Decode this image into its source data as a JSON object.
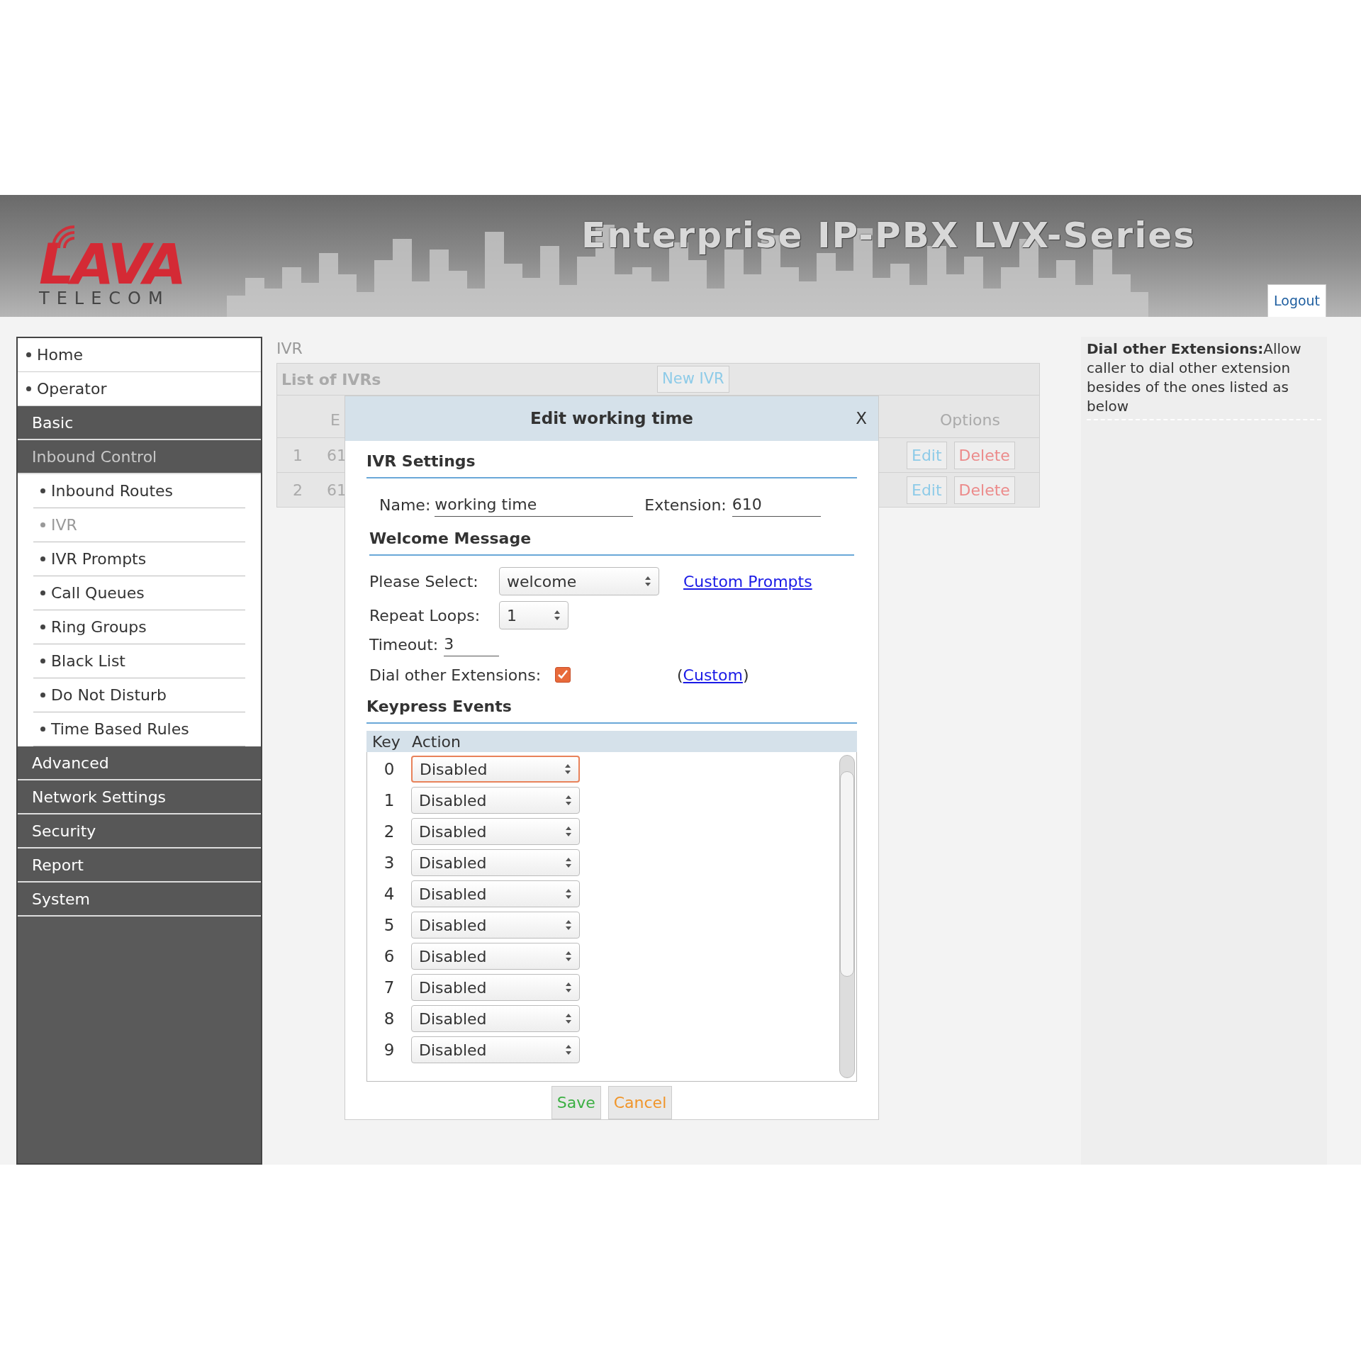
{
  "header": {
    "logo": "LAVA",
    "logo_subtitle": "TELECOM",
    "title": "Enterprise IP-PBX LVX-Series",
    "logout": "Logout"
  },
  "sidebar": {
    "items": [
      {
        "label": "Home",
        "kind": "link",
        "selected": false
      },
      {
        "label": "Operator",
        "kind": "link",
        "selected": false
      },
      {
        "label": "Basic",
        "kind": "section",
        "selected": false
      },
      {
        "label": "Inbound Control",
        "kind": "section",
        "selected": true,
        "children": [
          {
            "label": "Inbound Routes",
            "selected": false
          },
          {
            "label": "IVR",
            "selected": true
          },
          {
            "label": "IVR Prompts",
            "selected": false
          },
          {
            "label": "Call Queues",
            "selected": false
          },
          {
            "label": "Ring Groups",
            "selected": false
          },
          {
            "label": "Black List",
            "selected": false
          },
          {
            "label": "Do Not Disturb",
            "selected": false
          },
          {
            "label": "Time Based Rules",
            "selected": false
          }
        ]
      },
      {
        "label": "Advanced",
        "kind": "section",
        "selected": false
      },
      {
        "label": "Network Settings",
        "kind": "section",
        "selected": false
      },
      {
        "label": "Security",
        "kind": "section",
        "selected": false
      },
      {
        "label": "Report",
        "kind": "section",
        "selected": false
      },
      {
        "label": "System",
        "kind": "section",
        "selected": false
      }
    ]
  },
  "breadcrumb": "IVR",
  "ivr_list": {
    "title": "List of IVRs",
    "new_button": "New IVR",
    "columns": [
      "E",
      "Options"
    ],
    "rows": [
      {
        "index": "1",
        "column_2": "61",
        "edit": "Edit",
        "delete": "Delete"
      },
      {
        "index": "2",
        "column_2": "61",
        "edit": "Edit",
        "delete": "Delete"
      }
    ]
  },
  "dialog": {
    "title": "Edit working time",
    "close": "X",
    "ivr_settings": {
      "heading": "IVR Settings",
      "name_label": "Name:",
      "name": "working time",
      "extension_label": "Extension:",
      "extension": "610"
    },
    "welcome": {
      "heading": "Welcome Message",
      "select_label": "Please Select:",
      "select_value": "welcome",
      "custom_prompts": "Custom Prompts",
      "repeat_label": "Repeat Loops:",
      "repeat_value": "1",
      "timeout_label": "Timeout:",
      "timeout": "3",
      "dial_label": "Dial other Extensions:",
      "dial_checked": true,
      "custom_open": "(",
      "custom": "Custom",
      "custom_close": ")"
    },
    "keypress": {
      "heading": "Keypress Events",
      "columns": [
        "Key",
        "Action"
      ],
      "rows": [
        {
          "key": "0",
          "action": "Disabled",
          "focused": true
        },
        {
          "key": "1",
          "action": "Disabled",
          "focused": false
        },
        {
          "key": "2",
          "action": "Disabled",
          "focused": false
        },
        {
          "key": "3",
          "action": "Disabled",
          "focused": false
        },
        {
          "key": "4",
          "action": "Disabled",
          "focused": false
        },
        {
          "key": "5",
          "action": "Disabled",
          "focused": false
        },
        {
          "key": "6",
          "action": "Disabled",
          "focused": false
        },
        {
          "key": "7",
          "action": "Disabled",
          "focused": false
        },
        {
          "key": "8",
          "action": "Disabled",
          "focused": false
        },
        {
          "key": "9",
          "action": "Disabled",
          "focused": false
        }
      ]
    },
    "save": "Save",
    "cancel": "Cancel"
  },
  "help": {
    "text": "**Dial other Extensions:**Allow caller to dial other extension besides of the ones listed as below"
  }
}
